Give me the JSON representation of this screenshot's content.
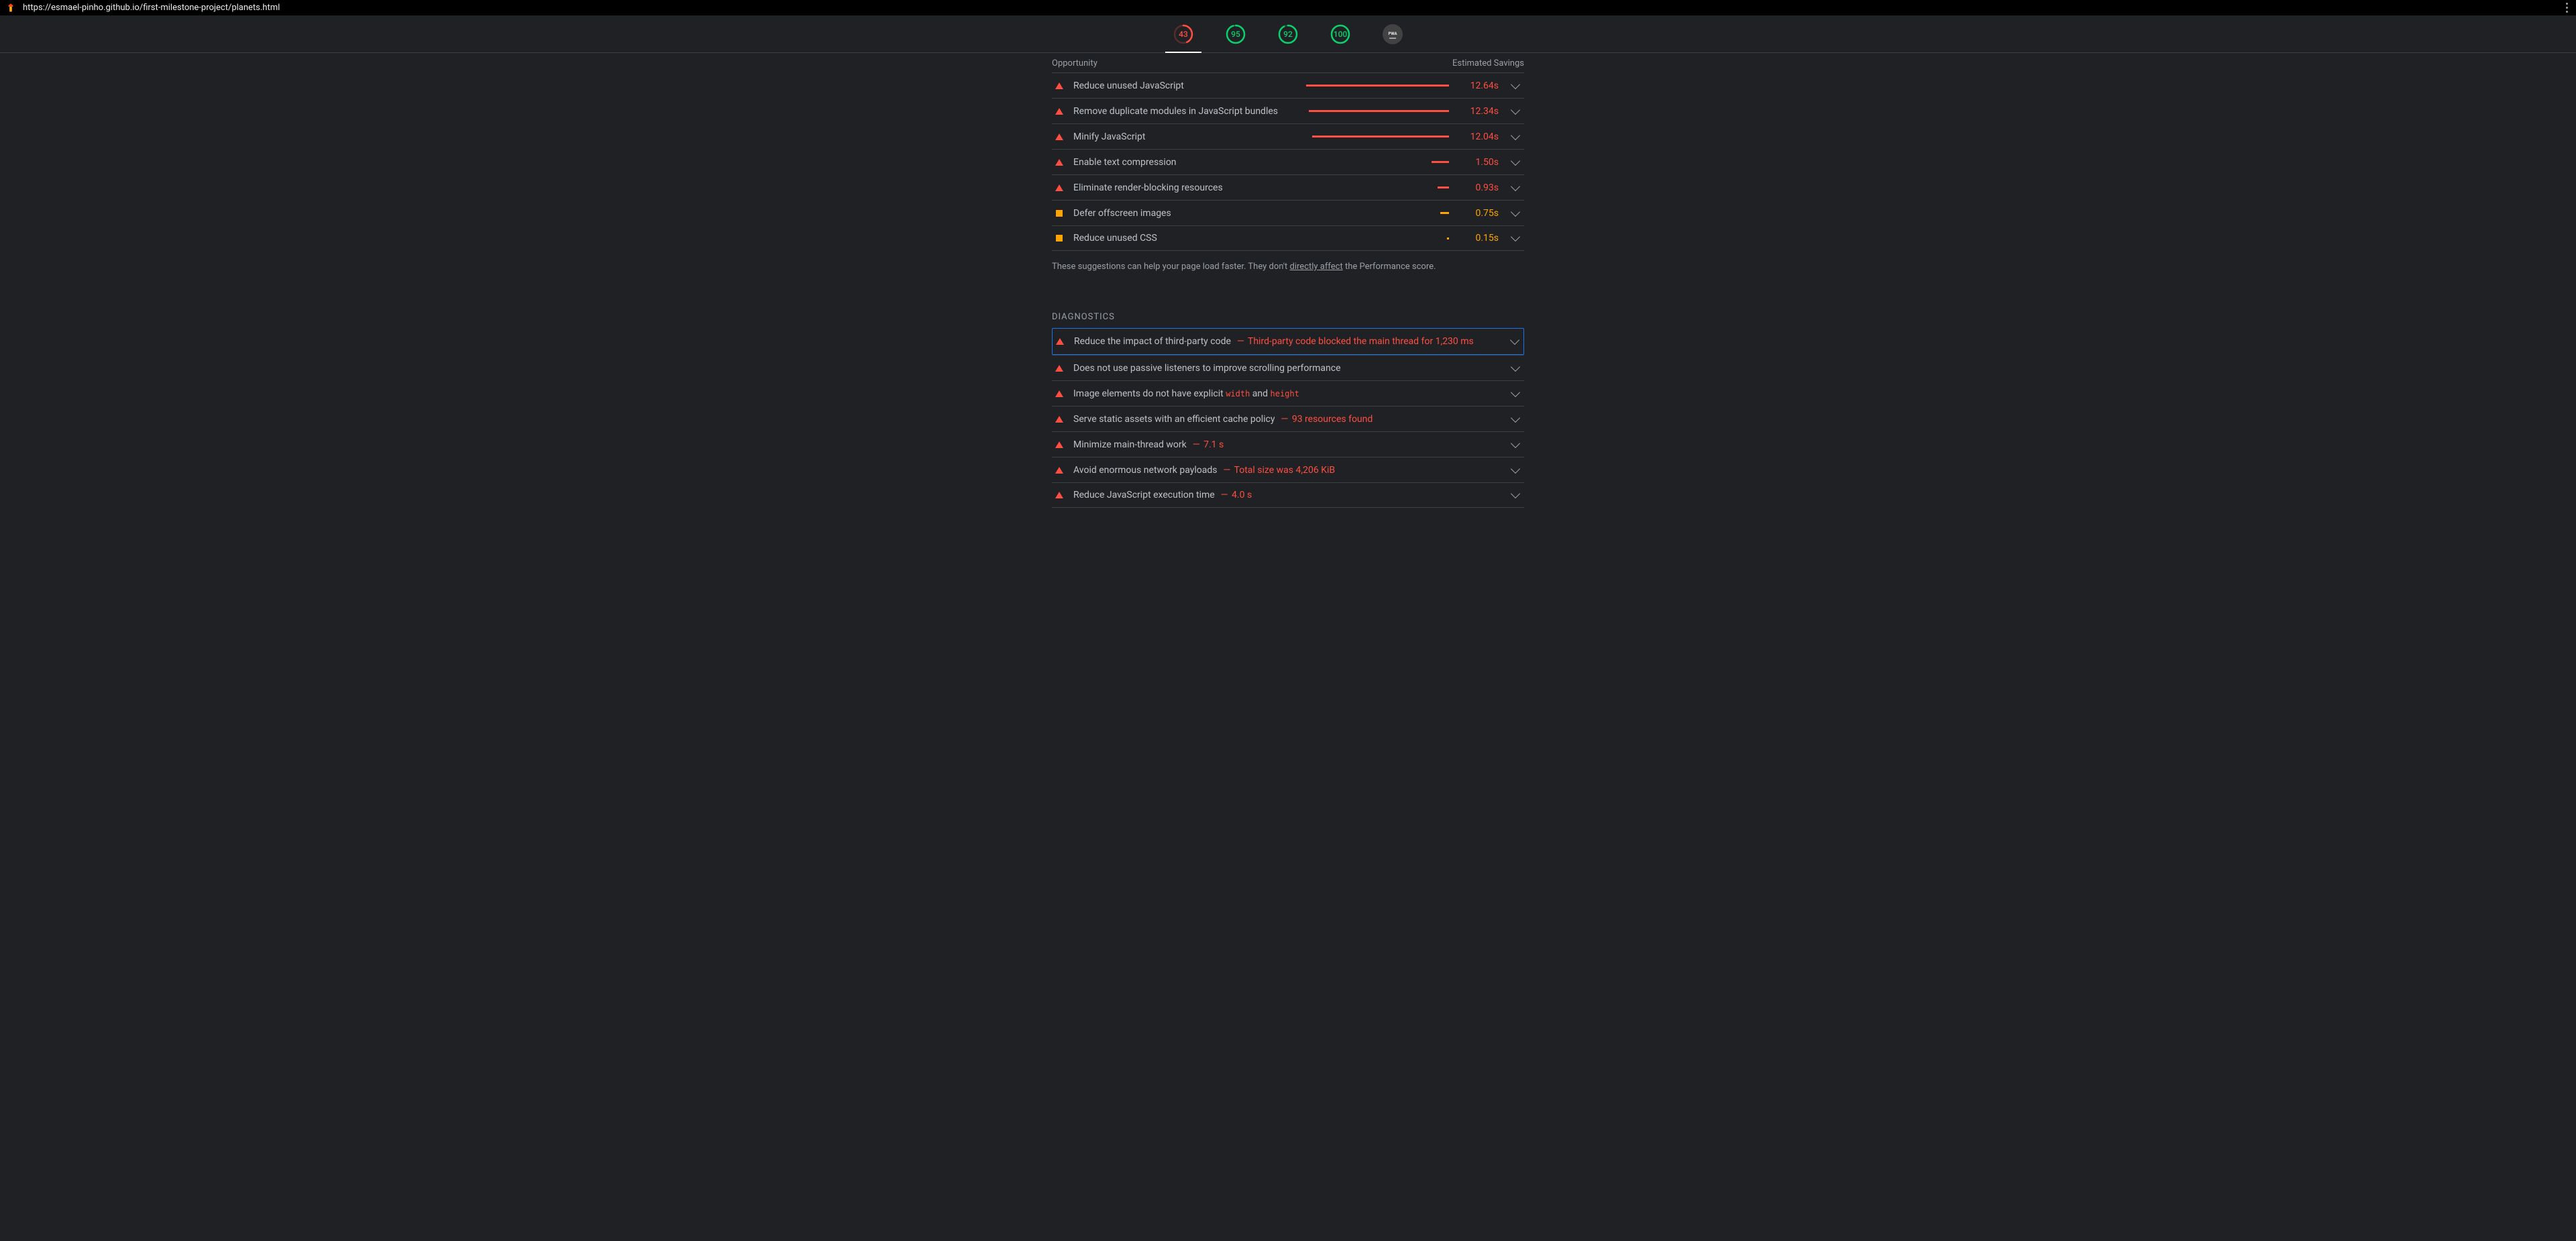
{
  "url": "https://esmael-pinho.github.io/first-milestone-project/planets.html",
  "gauges": [
    {
      "score": "43",
      "severity": "red",
      "active": true,
      "pct": 43
    },
    {
      "score": "95",
      "severity": "green",
      "active": false,
      "pct": 95
    },
    {
      "score": "92",
      "severity": "green",
      "active": false,
      "pct": 92
    },
    {
      "score": "100",
      "severity": "green",
      "active": false,
      "pct": 100
    }
  ],
  "pwa_label": "PWA",
  "opportunities": {
    "header_left": "Opportunity",
    "header_right": "Estimated Savings",
    "items": [
      {
        "severity": "red",
        "title": "Reduce unused JavaScript",
        "bar_pct": 100,
        "savings": "12.64s"
      },
      {
        "severity": "red",
        "title": "Remove duplicate modules in JavaScript bundles",
        "bar_pct": 98,
        "savings": "12.34s"
      },
      {
        "severity": "red",
        "title": "Minify JavaScript",
        "bar_pct": 96,
        "savings": "12.04s"
      },
      {
        "severity": "red",
        "title": "Enable text compression",
        "bar_pct": 12,
        "savings": "1.50s"
      },
      {
        "severity": "red",
        "title": "Eliminate render-blocking resources",
        "bar_pct": 8,
        "savings": "0.93s"
      },
      {
        "severity": "orange",
        "title": "Defer offscreen images",
        "bar_pct": 6,
        "savings": "0.75s"
      },
      {
        "severity": "orange",
        "title": "Reduce unused CSS",
        "bar_pct": 1.5,
        "savings": "0.15s"
      }
    ]
  },
  "opportunities_note_pre": "These suggestions can help your page load faster. They don't ",
  "opportunities_note_link": "directly affect",
  "opportunities_note_post": " the Performance score.",
  "diagnostics": {
    "heading": "DIAGNOSTICS",
    "items": [
      {
        "severity": "red",
        "title": "Reduce the impact of third-party code",
        "detail": "Third-party code blocked the main thread for 1,230 ms",
        "highlighted": true
      },
      {
        "severity": "red",
        "title": "Does not use passive listeners to improve scrolling performance",
        "detail": ""
      },
      {
        "severity": "red",
        "title_parts": [
          "Image elements do not have explicit ",
          "width",
          " and ",
          "height"
        ],
        "detail": ""
      },
      {
        "severity": "red",
        "title": "Serve static assets with an efficient cache policy",
        "detail": "93 resources found"
      },
      {
        "severity": "red",
        "title": "Minimize main-thread work",
        "detail": "7.1 s"
      },
      {
        "severity": "red",
        "title": "Avoid enormous network payloads",
        "detail": "Total size was 4,206 KiB"
      },
      {
        "severity": "red",
        "title": "Reduce JavaScript execution time",
        "detail": "4.0 s"
      }
    ]
  }
}
